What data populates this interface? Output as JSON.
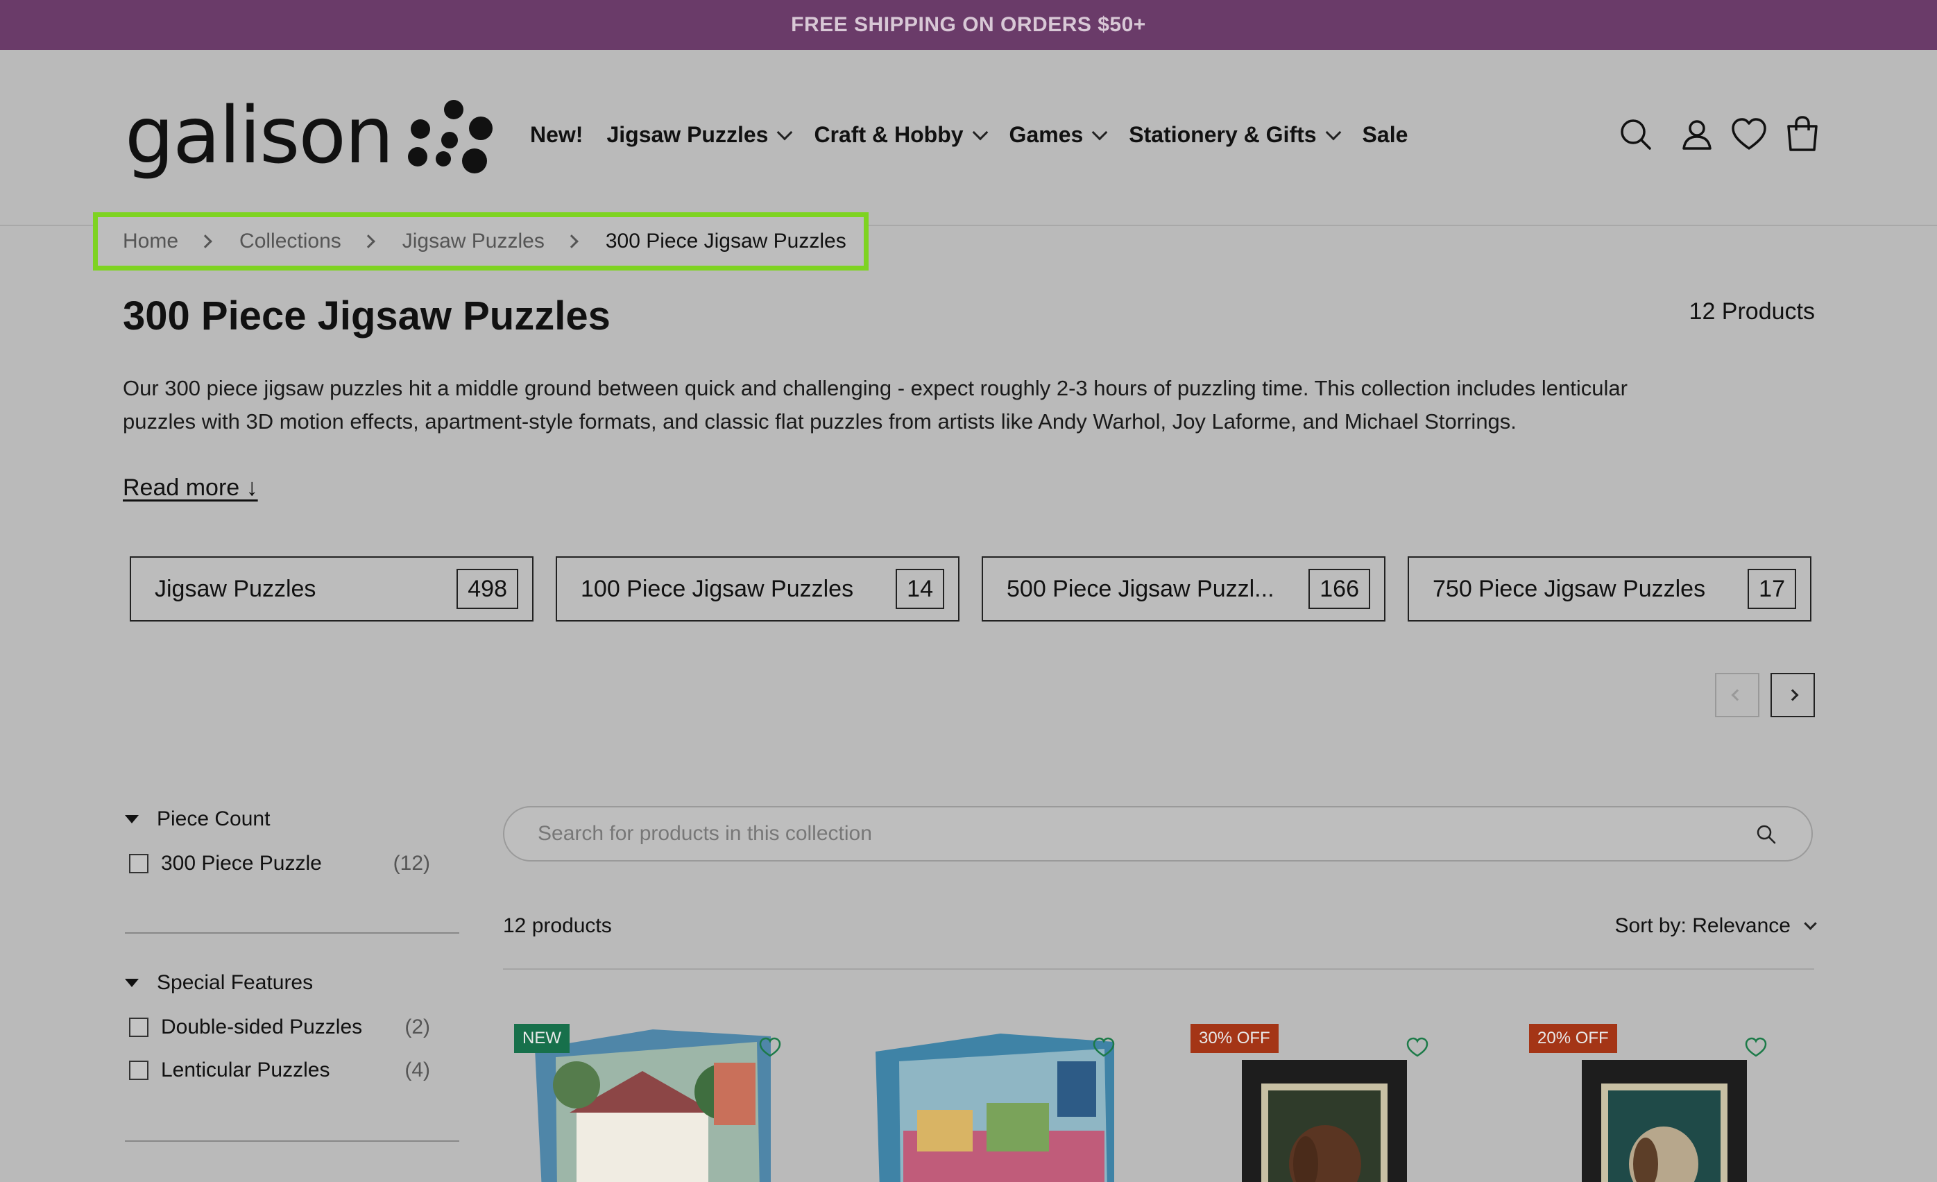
{
  "promo": {
    "text": "FREE SHIPPING ON ORDERS $50+"
  },
  "brand": {
    "logo_text": "galison"
  },
  "nav": {
    "items": [
      {
        "label": "New!",
        "has_dropdown": false
      },
      {
        "label": "Jigsaw Puzzles",
        "has_dropdown": true
      },
      {
        "label": "Craft & Hobby",
        "has_dropdown": true
      },
      {
        "label": "Games",
        "has_dropdown": true
      },
      {
        "label": "Stationery & Gifts",
        "has_dropdown": true
      },
      {
        "label": "Sale",
        "has_dropdown": false
      }
    ],
    "icons": [
      "search-icon",
      "account-icon",
      "wishlist-heart-icon",
      "cart-bag-icon"
    ]
  },
  "breadcrumb": {
    "items": [
      "Home",
      "Collections",
      "Jigsaw Puzzles"
    ],
    "current": "300 Piece Jigsaw Puzzles"
  },
  "page": {
    "title": "300 Piece Jigsaw Puzzles",
    "product_count": "12 Products",
    "description": "Our 300 piece jigsaw puzzles hit a middle ground between quick and challenging - expect roughly 2-3 hours of puzzling time. This collection includes lenticular puzzles with 3D motion effects, apartment-style formats, and classic flat puzzles from artists like Andy Warhol, Joy Laforme, and Michael Storrings.",
    "read_more": "Read more ↓"
  },
  "collections": [
    {
      "label": "Jigsaw Puzzles",
      "count": "498"
    },
    {
      "label": "100 Piece Jigsaw Puzzles",
      "count": "14"
    },
    {
      "label": "500 Piece Jigsaw Puzzl...",
      "count": "166"
    },
    {
      "label": "750 Piece Jigsaw Puzzles",
      "count": "17"
    }
  ],
  "filters": {
    "piece_count": {
      "title": "Piece Count",
      "options": [
        {
          "label": "300 Piece Puzzle",
          "count": "(12)"
        }
      ]
    },
    "special_features": {
      "title": "Special Features",
      "options": [
        {
          "label": "Double-sided Puzzles",
          "count": "(2)"
        },
        {
          "label": "Lenticular Puzzles",
          "count": "(4)"
        }
      ]
    }
  },
  "search": {
    "placeholder": "Search for products in this collection"
  },
  "results": {
    "count": "12 products",
    "sort_label": "Sort by:",
    "sort_value": "Relevance"
  },
  "products": [
    {
      "badge": "NEW",
      "badge_type": "new"
    },
    {
      "badge": "",
      "badge_type": ""
    },
    {
      "badge": "30% OFF",
      "badge_type": "off"
    },
    {
      "badge": "20% OFF",
      "badge_type": "off"
    }
  ],
  "colors": {
    "promo_bg": "#6a3b69",
    "highlight": "#7ed321",
    "new_badge": "#17704b",
    "sale_badge": "#a43516",
    "heart": "#1c7a48"
  }
}
